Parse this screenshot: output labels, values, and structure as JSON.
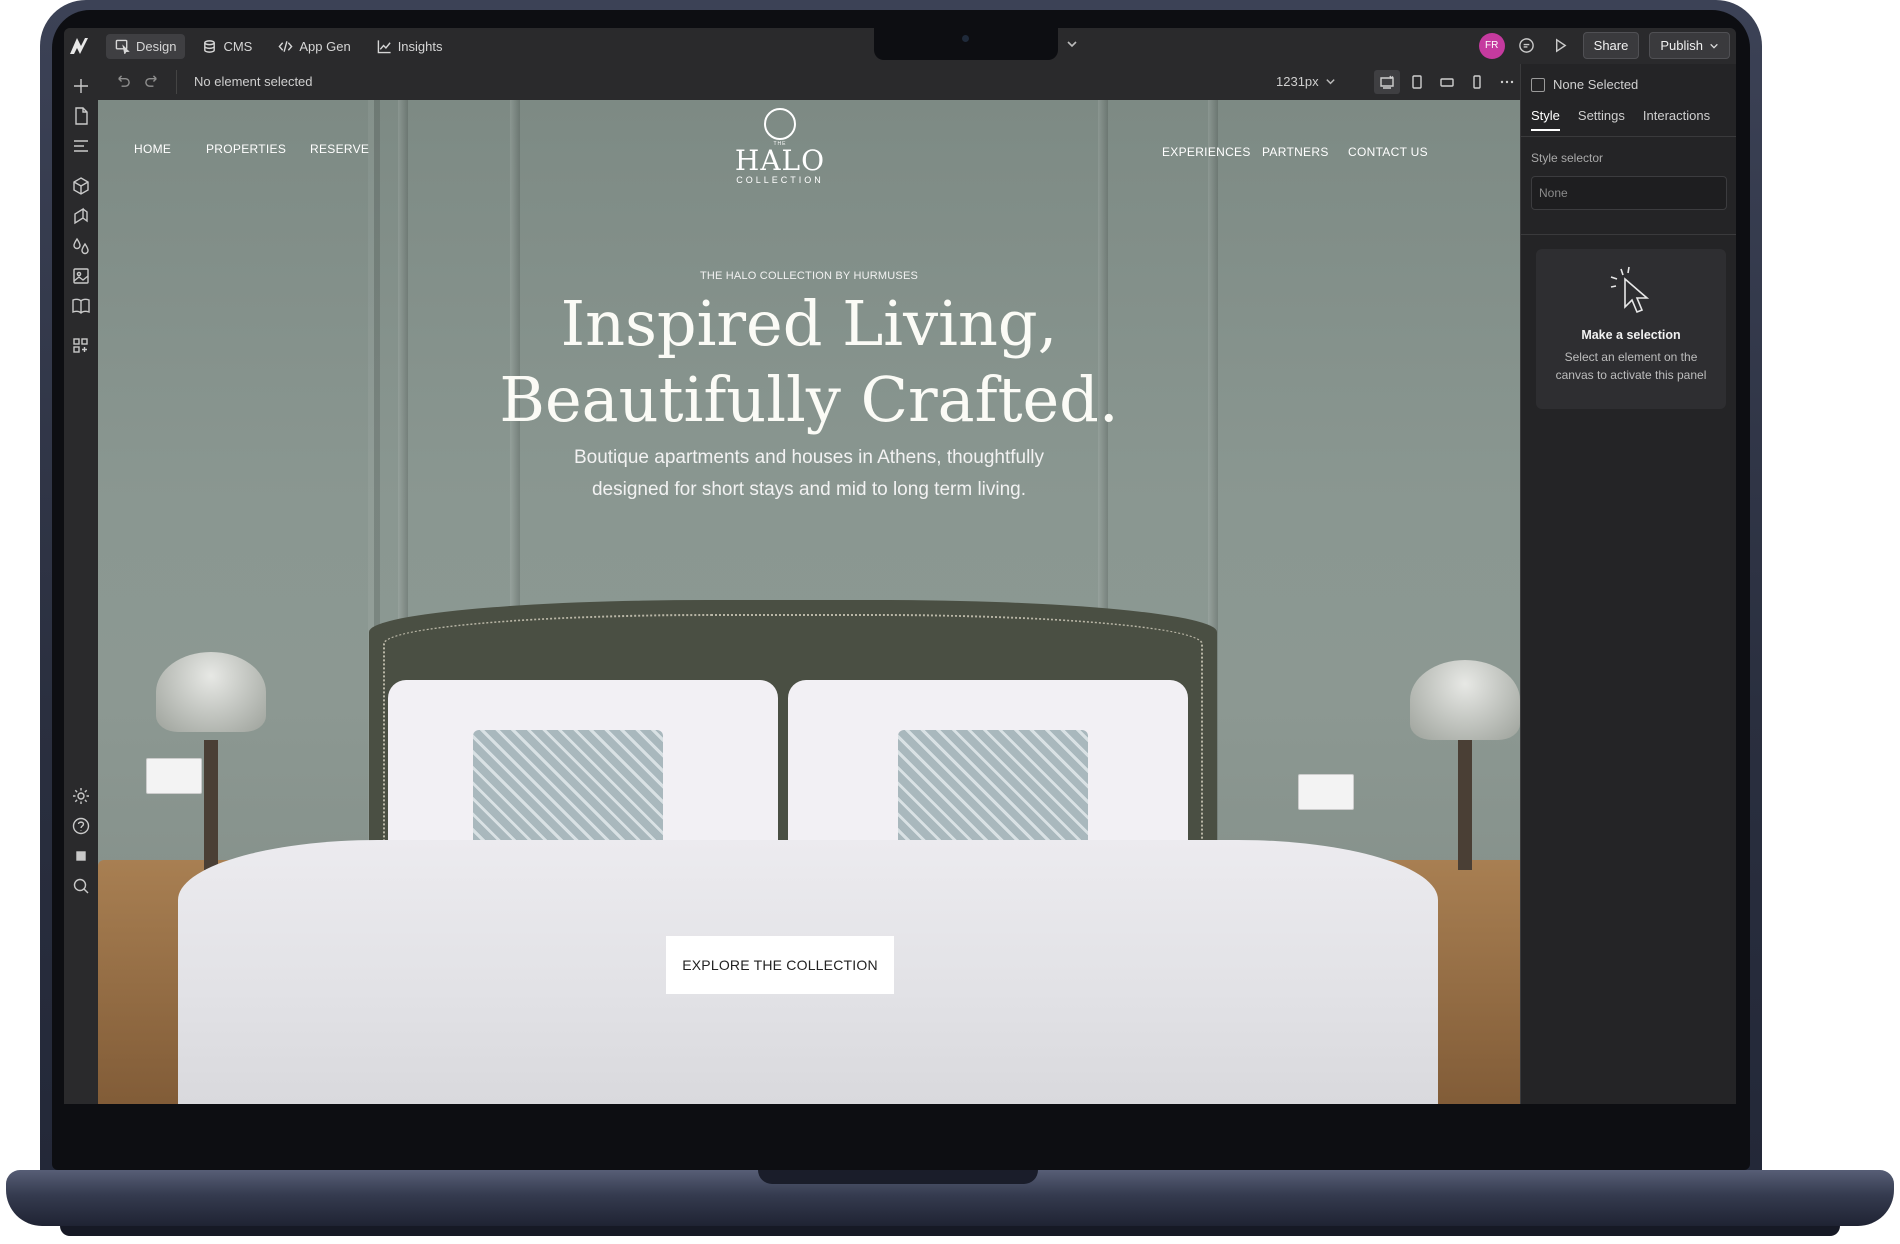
{
  "topbar": {
    "tabs": [
      {
        "label": "Design",
        "icon": "cursor-square-icon"
      },
      {
        "label": "CMS",
        "icon": "database-icon"
      },
      {
        "label": "App Gen",
        "icon": "code-icon"
      },
      {
        "label": "Insights",
        "icon": "chart-icon"
      }
    ],
    "avatar_initials": "FR",
    "share_label": "Share",
    "publish_label": "Publish"
  },
  "toolbar": {
    "status": "No element selected",
    "breakpoint": "1231px"
  },
  "site": {
    "nav_left": [
      "HOME",
      "PROPERTIES",
      "RESERVE"
    ],
    "nav_right": [
      "EXPERIENCES",
      "PARTNERS",
      "CONTACT US"
    ],
    "brand": {
      "the": "THE",
      "name": "HALO",
      "sub": "COLLECTION"
    },
    "eyebrow": "THE HALO COLLECTION BY HURMUSES",
    "headline_1": "Inspired Living,",
    "headline_2": "Beautifully Crafted.",
    "subtext_1": "Boutique apartments and houses in Athens, thoughtfully",
    "subtext_2": "designed for short stays and mid to long term living.",
    "cta": "EXPLORE THE COLLECTION"
  },
  "right_panel": {
    "none_selected": "None Selected",
    "tabs": [
      "Style",
      "Settings",
      "Interactions"
    ],
    "style_selector_label": "Style selector",
    "style_selector_value": "None",
    "card_title": "Make a selection",
    "card_text": "Select an element on the canvas to activate this panel"
  },
  "colors": {
    "accent_avatar": "#c53a9f",
    "canvas_wall": "#8a9791",
    "editor_bg": "#2a2a2c"
  }
}
